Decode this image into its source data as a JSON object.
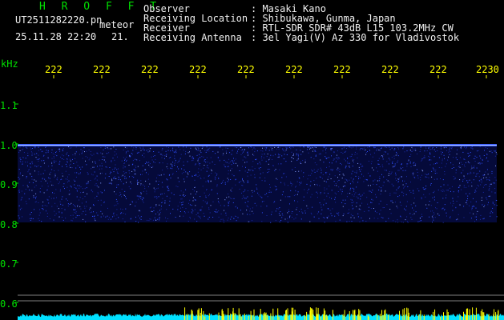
{
  "header": {
    "station": "H R O F F T",
    "filename": "UT2511282220.pn",
    "mode": "meteor",
    "datetime": "25.11.28 22:20",
    "count": "21."
  },
  "info": [
    {
      "key": "Observer",
      "value": ": Masaki Kano"
    },
    {
      "key": "Receiving Location",
      "value": ": Shibukawa, Gunma, Japan"
    },
    {
      "key": "Receiver",
      "value": ": RTL-SDR SDR# 43dB L15 103.2MHz CW"
    },
    {
      "key": "Receiving Antenna",
      "value": ": 3el Yagi(V) Az 330 for Vladivostok"
    }
  ],
  "plot": {
    "y_unit": "kHz",
    "y_ticks": [
      "1.1",
      "1.0",
      "0.9",
      "0.8",
      "0.7",
      "0.6"
    ],
    "x_ticks": [
      "222",
      "222",
      "222",
      "222",
      "222",
      "222",
      "222",
      "222",
      "222",
      "2230"
    ],
    "colors": {
      "axis": "#00e000",
      "signal": "#3050ff",
      "carrier": "#a0c0ff",
      "noise_floor": "#00e0ff",
      "spikes": "#ffff00"
    }
  }
}
